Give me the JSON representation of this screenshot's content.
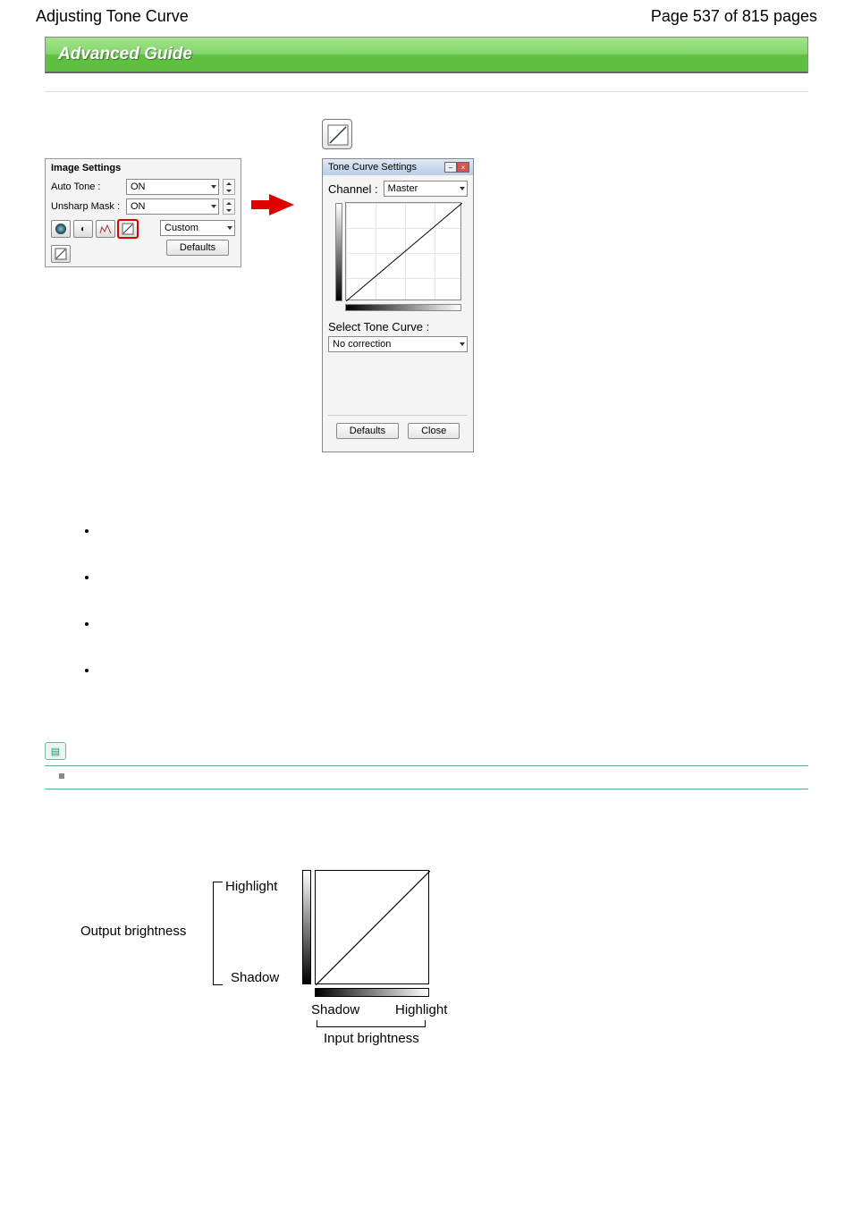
{
  "header": {
    "title": "Adjusting Tone Curve",
    "page_info": "Page 537 of 815 pages"
  },
  "banner": "Advanced Guide",
  "image_settings": {
    "title": "Image Settings",
    "auto_tone_label": "Auto Tone :",
    "auto_tone_value": "ON",
    "unsharp_label": "Unsharp Mask :",
    "unsharp_value": "ON",
    "custom_value": "Custom",
    "defaults_btn": "Defaults"
  },
  "tone_curve_dialog": {
    "title": "Tone Curve Settings",
    "channel_label": "Channel :",
    "channel_value": "Master",
    "select_label": "Select Tone Curve :",
    "select_value": "No correction",
    "defaults_btn": "Defaults",
    "close_btn": "Close"
  },
  "bullets": [
    "",
    "",
    "",
    ""
  ],
  "diagram": {
    "output": "Output brightness",
    "highlight": "Highlight",
    "shadow": "Shadow",
    "input": "Input brightness"
  },
  "chart_data": {
    "type": "line",
    "title": "Tone Curve",
    "xlabel": "Input brightness",
    "ylabel": "Output brightness",
    "xlim": [
      0,
      255
    ],
    "ylim": [
      0,
      255
    ],
    "x_endpoints": {
      "low": "Shadow",
      "high": "Highlight"
    },
    "y_endpoints": {
      "low": "Shadow",
      "high": "Highlight"
    },
    "series": [
      {
        "name": "No correction",
        "x": [
          0,
          255
        ],
        "y": [
          0,
          255
        ]
      }
    ]
  }
}
